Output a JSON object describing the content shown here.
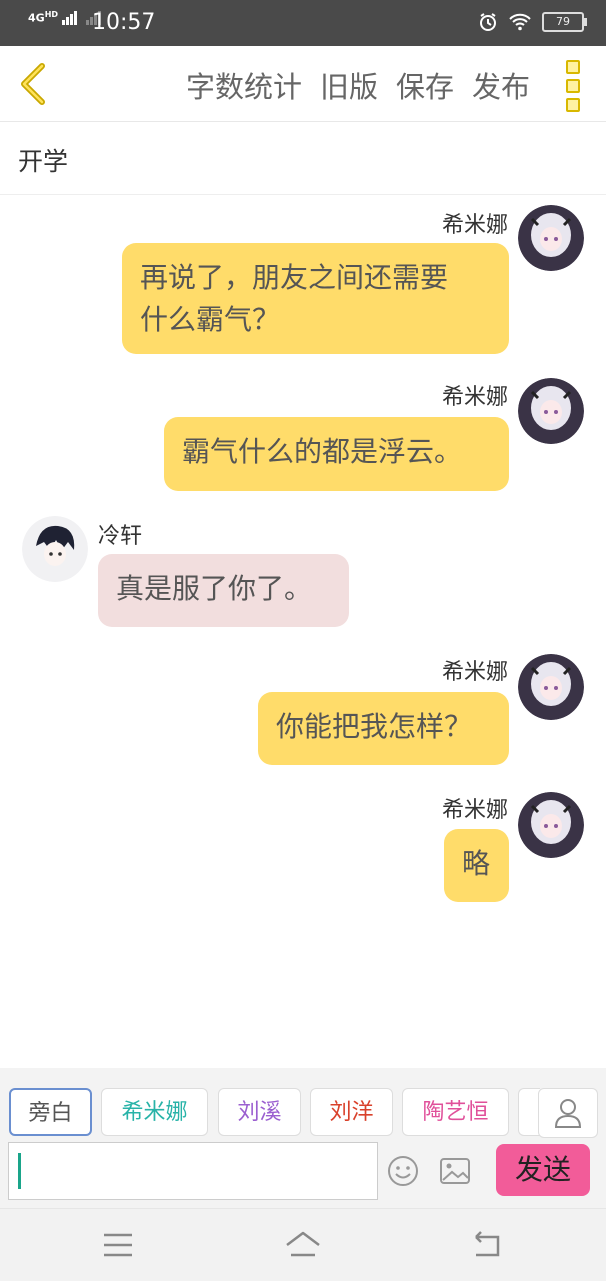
{
  "status": {
    "network": "4G",
    "network_badge": "HD",
    "time": "10:57",
    "battery": "79"
  },
  "toolbar": {
    "items": [
      "字数统计",
      "旧版",
      "保存",
      "发布"
    ]
  },
  "title": "开学",
  "messages": [
    {
      "name": "希米娜",
      "text_lines": [
        "再说了，朋友之间还需要",
        "什么霸气？"
      ]
    },
    {
      "name": "希米娜",
      "text_lines": [
        "霸气什么的都是浮云。"
      ]
    },
    {
      "name": "冷轩",
      "text_lines": [
        "真是服了你了。"
      ]
    },
    {
      "name": "希米娜",
      "text_lines": [
        "你能把我怎样？"
      ]
    },
    {
      "name": "希米娜",
      "text_lines": [
        "略"
      ]
    }
  ],
  "characters": [
    {
      "label": "旁白",
      "color": "#555555"
    },
    {
      "label": "希米娜",
      "color": "#28b3a8"
    },
    {
      "label": "刘溪",
      "color": "#9b5fd0"
    },
    {
      "label": "刘洋",
      "color": "#d9412b"
    },
    {
      "label": "陶艺恒",
      "color": "#e0509a"
    }
  ],
  "input": {
    "value": ""
  },
  "send_label": "发送"
}
